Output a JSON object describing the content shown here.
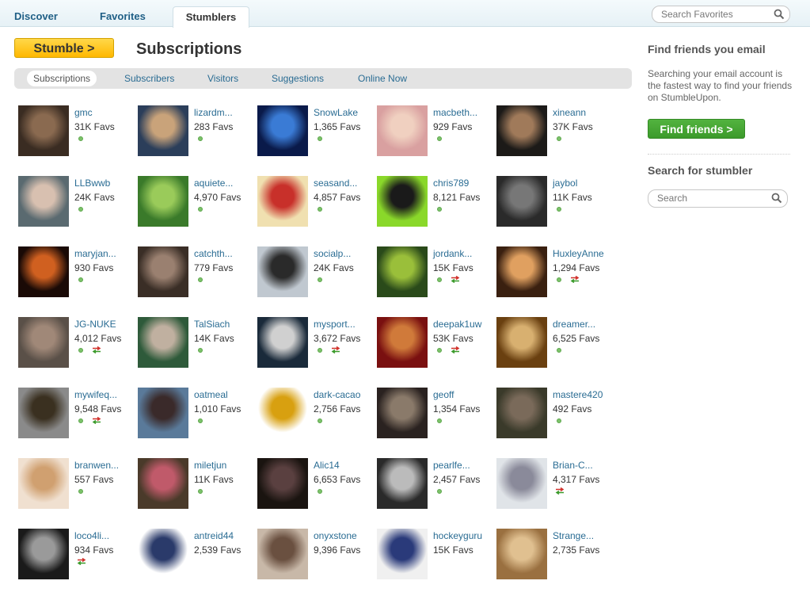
{
  "tabs": [
    {
      "label": "Discover"
    },
    {
      "label": "Favorites"
    },
    {
      "label": "Stumblers"
    }
  ],
  "search_favorites_placeholder": "Search Favorites",
  "stumble_label": "Stumble >",
  "page_title": "Subscriptions",
  "subnav": [
    "Subscriptions",
    "Subscribers",
    "Visitors",
    "Suggestions",
    "Online Now"
  ],
  "sidebar": {
    "find_heading": "Find friends you email",
    "find_text": "Searching your email account is the fastest way to find your friends on StumbleUpon.",
    "find_button": "Find friends >",
    "search_heading": "Search for stumbler",
    "search_placeholder": "Search"
  },
  "users": [
    {
      "name": "gmc",
      "favs": "31K Favs",
      "online": true,
      "mutual": false
    },
    {
      "name": "lizardm...",
      "favs": "283 Favs",
      "online": true,
      "mutual": false
    },
    {
      "name": "SnowLake",
      "favs": "1,365 Favs",
      "online": true,
      "mutual": false
    },
    {
      "name": "macbeth...",
      "favs": "929 Favs",
      "online": true,
      "mutual": false
    },
    {
      "name": "xineann",
      "favs": "37K Favs",
      "online": true,
      "mutual": false
    },
    {
      "name": "LLBwwb",
      "favs": "24K Favs",
      "online": true,
      "mutual": false
    },
    {
      "name": "aquiete...",
      "favs": "4,970 Favs",
      "online": true,
      "mutual": false
    },
    {
      "name": "seasand...",
      "favs": "4,857 Favs",
      "online": true,
      "mutual": false
    },
    {
      "name": "chris789",
      "favs": "8,121 Favs",
      "online": true,
      "mutual": false
    },
    {
      "name": "jaybol",
      "favs": "11K Favs",
      "online": true,
      "mutual": false
    },
    {
      "name": "maryjan...",
      "favs": "930 Favs",
      "online": true,
      "mutual": false
    },
    {
      "name": "catchth...",
      "favs": "779 Favs",
      "online": true,
      "mutual": false
    },
    {
      "name": "socialp...",
      "favs": "24K Favs",
      "online": true,
      "mutual": false
    },
    {
      "name": "jordank...",
      "favs": "15K Favs",
      "online": true,
      "mutual": true
    },
    {
      "name": "HuxleyAnne",
      "favs": "1,294 Favs",
      "online": true,
      "mutual": true
    },
    {
      "name": "JG-NUKE",
      "favs": "4,012 Favs",
      "online": true,
      "mutual": true
    },
    {
      "name": "TalSiach",
      "favs": "14K Favs",
      "online": true,
      "mutual": false
    },
    {
      "name": "mysport...",
      "favs": "3,672 Favs",
      "online": true,
      "mutual": true
    },
    {
      "name": "deepak1uw",
      "favs": "53K Favs",
      "online": true,
      "mutual": true
    },
    {
      "name": "dreamer...",
      "favs": "6,525 Favs",
      "online": true,
      "mutual": false
    },
    {
      "name": "mywifeq...",
      "favs": "9,548 Favs",
      "online": true,
      "mutual": true
    },
    {
      "name": "oatmeal",
      "favs": "1,010 Favs",
      "online": true,
      "mutual": false
    },
    {
      "name": "dark-cacao",
      "favs": "2,756 Favs",
      "online": true,
      "mutual": false
    },
    {
      "name": "geoff",
      "favs": "1,354 Favs",
      "online": true,
      "mutual": false
    },
    {
      "name": "mastere420",
      "favs": "492 Favs",
      "online": true,
      "mutual": false
    },
    {
      "name": "branwen...",
      "favs": "557 Favs",
      "online": true,
      "mutual": false
    },
    {
      "name": "miletjun",
      "favs": "11K Favs",
      "online": true,
      "mutual": false
    },
    {
      "name": "Alic14",
      "favs": "6,653 Favs",
      "online": true,
      "mutual": false
    },
    {
      "name": "pearlfe...",
      "favs": "2,457 Favs",
      "online": true,
      "mutual": false
    },
    {
      "name": "Brian-C...",
      "favs": "4,317 Favs",
      "online": false,
      "mutual": true
    },
    {
      "name": "loco4li...",
      "favs": "934 Favs",
      "online": false,
      "mutual": true
    },
    {
      "name": "antreid44",
      "favs": "2,539 Favs",
      "online": false,
      "mutual": false
    },
    {
      "name": "onyxstone",
      "favs": "9,396 Favs",
      "online": false,
      "mutual": false
    },
    {
      "name": "hockeyguru",
      "favs": "15K Favs",
      "online": false,
      "mutual": false
    },
    {
      "name": "Strange...",
      "favs": "2,735 Favs",
      "online": false,
      "mutual": false
    }
  ]
}
